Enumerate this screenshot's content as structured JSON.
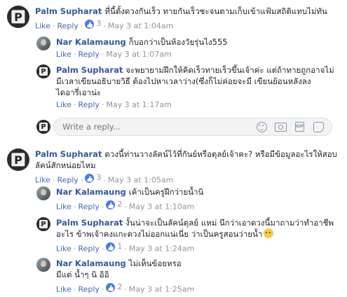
{
  "ui": {
    "like_label": "Like",
    "reply_label": "Reply",
    "dot": "·"
  },
  "thread1": {
    "main": {
      "author": "Palm Supharat",
      "text": "ที่นี้ตั้งดวงกันเร็ว ทายกันเร็วชะจนตามเก็บเข้าแฟ้มสถิติแทบไม่ทัน",
      "time": "May 3 at 1:04am",
      "likes": "3"
    },
    "replies": [
      {
        "author": "Nar Kalamaung",
        "text": "ก็บอกว่าเป็นห้องวัยรุ่นไง555",
        "time": "May 3 at 1:07am",
        "likes": ""
      },
      {
        "author": "Palm Supharat",
        "text1": "จะพยายามฝึกให้คิดเร็วทายเร็วขึ้นเจ้าค่ะ แต่ถ้าทายถูกอาจไม่",
        "text2": "มีเวลาเขียนอธิบายวิธี ต้องไปหาเวลาว่าง(ซึ่งก็ไม่ค่อยจะมี เขียนย้อนหลังลง",
        "text3": "ไดอารี่เอาน่ะ",
        "time": "May 3 at 1:17am",
        "likes": ""
      }
    ],
    "reply_input": {
      "placeholder": "Write a reply..."
    }
  },
  "thread2": {
    "main": {
      "author": "Palm Supharat",
      "text1": "ดวงนี้ท่านวางลัคน์ไว้ที่กันย์หรือตุลย์เจ้าคะ? หรือมีข้อมูลอะไรให้สอบ",
      "text2": "ลัคน์สักหน่อยไหม",
      "time": "May 3 at 1:05am",
      "likes": "3"
    },
    "replies": [
      {
        "author": "Nar Kalamaung",
        "text": "เค้าเป็นครูฝึกว่ายน้ำนิ",
        "time": "May 3 at 1:10am",
        "likes": "2"
      },
      {
        "author": "Palm Supharat",
        "text1": "งั้นน่าจะเป็นลัคน์ตุลย์ แหม่ นึกว่าเอาดวงนี้มาถามว่าทำอาชีพ",
        "text2": "อะไร ข้าพเจ้าคงแกะดวงไม่ออกแน่เนี่ย ว่าเป็นครูสอนว่ายน้ำ",
        "time": "May 3 at 1:24am",
        "likes": "1"
      },
      {
        "author": "Nar Kalamaung",
        "text1": "ไม่เห็นข้อยหรอ",
        "text2": "มีแต่ น้ำๆ นิ อิอิ",
        "time": "May 3 at 1:25am",
        "likes": "2"
      }
    ]
  }
}
